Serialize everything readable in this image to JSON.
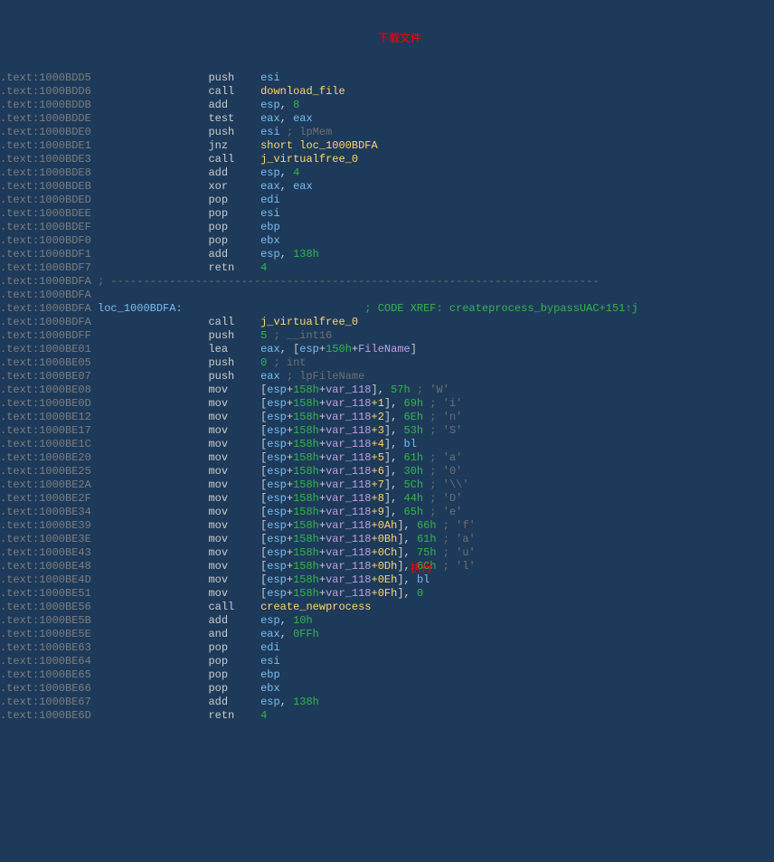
{
  "anno": {
    "download": "下载文件",
    "run": "执行"
  },
  "lines": [
    {
      "addr": ".text:1000BDD5",
      "col2": "",
      "mnem": "push",
      "ops": [
        {
          "t": "reg",
          "v": "esi"
        }
      ]
    },
    {
      "addr": ".text:1000BDD6",
      "col2": "",
      "mnem": "call",
      "ops": [
        {
          "t": "func",
          "v": "download_file"
        }
      ]
    },
    {
      "addr": ".text:1000BDDB",
      "col2": "",
      "mnem": "add",
      "ops": [
        {
          "t": "reg",
          "v": "esp"
        },
        {
          "t": "txt",
          "v": ", "
        },
        {
          "t": "num",
          "v": "8"
        }
      ]
    },
    {
      "addr": ".text:1000BDDE",
      "col2": "",
      "mnem": "test",
      "ops": [
        {
          "t": "reg",
          "v": "eax"
        },
        {
          "t": "txt",
          "v": ", "
        },
        {
          "t": "reg",
          "v": "eax"
        }
      ]
    },
    {
      "addr": ".text:1000BDE0",
      "col2": "",
      "mnem": "push",
      "ops": [
        {
          "t": "reg",
          "v": "esi"
        }
      ],
      "cmt": "; lpMem",
      "cmtcol": 42
    },
    {
      "addr": ".text:1000BDE1",
      "col2": "",
      "mnem": "jnz",
      "ops": [
        {
          "t": "func",
          "v": "short loc_1000BDFA"
        }
      ]
    },
    {
      "addr": ".text:1000BDE3",
      "col2": "",
      "mnem": "call",
      "ops": [
        {
          "t": "func",
          "v": "j_virtualfree_0"
        }
      ]
    },
    {
      "addr": ".text:1000BDE8",
      "col2": "",
      "mnem": "add",
      "ops": [
        {
          "t": "reg",
          "v": "esp"
        },
        {
          "t": "txt",
          "v": ", "
        },
        {
          "t": "num",
          "v": "4"
        }
      ]
    },
    {
      "addr": ".text:1000BDEB",
      "col2": "",
      "mnem": "xor",
      "ops": [
        {
          "t": "reg",
          "v": "eax"
        },
        {
          "t": "txt",
          "v": ", "
        },
        {
          "t": "reg",
          "v": "eax"
        }
      ]
    },
    {
      "addr": ".text:1000BDED",
      "col2": "",
      "mnem": "pop",
      "ops": [
        {
          "t": "reg",
          "v": "edi"
        }
      ]
    },
    {
      "addr": ".text:1000BDEE",
      "col2": "",
      "mnem": "pop",
      "ops": [
        {
          "t": "reg",
          "v": "esi"
        }
      ]
    },
    {
      "addr": ".text:1000BDEF",
      "col2": "",
      "mnem": "pop",
      "ops": [
        {
          "t": "reg",
          "v": "ebp"
        }
      ]
    },
    {
      "addr": ".text:1000BDF0",
      "col2": "",
      "mnem": "pop",
      "ops": [
        {
          "t": "reg",
          "v": "ebx"
        }
      ]
    },
    {
      "addr": ".text:1000BDF1",
      "col2": "",
      "mnem": "add",
      "ops": [
        {
          "t": "reg",
          "v": "esp"
        },
        {
          "t": "txt",
          "v": ", "
        },
        {
          "t": "num",
          "v": "138h"
        }
      ]
    },
    {
      "addr": ".text:1000BDF7",
      "col2": "",
      "mnem": "retn",
      "ops": [
        {
          "t": "num",
          "v": "4"
        }
      ]
    },
    {
      "addr": ".text:1000BDFA",
      "sep": true
    },
    {
      "addr": ".text:1000BDFA",
      "blank": true
    },
    {
      "addr": ".text:1000BDFA",
      "loc": "loc_1000BDFA:",
      "xref": "; CODE XREF: createprocess_bypassUAC+151↑j"
    },
    {
      "addr": ".text:1000BDFA",
      "col2": "",
      "mnem": "call",
      "ops": [
        {
          "t": "func",
          "v": "j_virtualfree_0"
        }
      ]
    },
    {
      "addr": ".text:1000BDFF",
      "col2": "",
      "mnem": "push",
      "ops": [
        {
          "t": "num",
          "v": "5"
        }
      ],
      "cmt": "; __int16",
      "cmtcol": 42
    },
    {
      "addr": ".text:1000BE01",
      "col2": "",
      "mnem": "lea",
      "ops": [
        {
          "t": "reg",
          "v": "eax"
        },
        {
          "t": "txt",
          "v": ", ["
        },
        {
          "t": "reg",
          "v": "esp"
        },
        {
          "t": "txt",
          "v": "+"
        },
        {
          "t": "num",
          "v": "150h"
        },
        {
          "t": "txt",
          "v": "+"
        },
        {
          "t": "var",
          "v": "FileName"
        },
        {
          "t": "txt",
          "v": "]"
        }
      ]
    },
    {
      "addr": ".text:1000BE05",
      "col2": "",
      "mnem": "push",
      "ops": [
        {
          "t": "num",
          "v": "0"
        }
      ],
      "cmt": "; int",
      "cmtcol": 42
    },
    {
      "addr": ".text:1000BE07",
      "col2": "",
      "mnem": "push",
      "ops": [
        {
          "t": "reg",
          "v": "eax"
        }
      ],
      "cmt": "; lpFileName",
      "cmtcol": 42
    },
    {
      "addr": ".text:1000BE08",
      "col2": "",
      "mnem": "mov",
      "ops": [
        {
          "t": "txt",
          "v": "["
        },
        {
          "t": "reg",
          "v": "esp"
        },
        {
          "t": "txt",
          "v": "+"
        },
        {
          "t": "num",
          "v": "158h"
        },
        {
          "t": "txt",
          "v": "+"
        },
        {
          "t": "var",
          "v": "var_118"
        },
        {
          "t": "txt",
          "v": "], "
        },
        {
          "t": "num",
          "v": "57h"
        }
      ],
      "cmt2": " ; 'W'"
    },
    {
      "addr": ".text:1000BE0D",
      "col2": "",
      "mnem": "mov",
      "ops": [
        {
          "t": "txt",
          "v": "["
        },
        {
          "t": "reg",
          "v": "esp"
        },
        {
          "t": "txt",
          "v": "+"
        },
        {
          "t": "num",
          "v": "158h"
        },
        {
          "t": "txt",
          "v": "+"
        },
        {
          "t": "var",
          "v": "var_118"
        },
        {
          "t": "off",
          "v": "+1"
        },
        {
          "t": "txt",
          "v": "], "
        },
        {
          "t": "num",
          "v": "69h"
        }
      ],
      "cmt2": " ; 'i'"
    },
    {
      "addr": ".text:1000BE12",
      "col2": "",
      "mnem": "mov",
      "ops": [
        {
          "t": "txt",
          "v": "["
        },
        {
          "t": "reg",
          "v": "esp"
        },
        {
          "t": "txt",
          "v": "+"
        },
        {
          "t": "num",
          "v": "158h"
        },
        {
          "t": "txt",
          "v": "+"
        },
        {
          "t": "var",
          "v": "var_118"
        },
        {
          "t": "off",
          "v": "+2"
        },
        {
          "t": "txt",
          "v": "], "
        },
        {
          "t": "num",
          "v": "6Eh"
        }
      ],
      "cmt2": " ; 'n'"
    },
    {
      "addr": ".text:1000BE17",
      "col2": "",
      "mnem": "mov",
      "ops": [
        {
          "t": "txt",
          "v": "["
        },
        {
          "t": "reg",
          "v": "esp"
        },
        {
          "t": "txt",
          "v": "+"
        },
        {
          "t": "num",
          "v": "158h"
        },
        {
          "t": "txt",
          "v": "+"
        },
        {
          "t": "var",
          "v": "var_118"
        },
        {
          "t": "off",
          "v": "+3"
        },
        {
          "t": "txt",
          "v": "], "
        },
        {
          "t": "num",
          "v": "53h"
        }
      ],
      "cmt2": " ; 'S'"
    },
    {
      "addr": ".text:1000BE1C",
      "col2": "",
      "mnem": "mov",
      "ops": [
        {
          "t": "txt",
          "v": "["
        },
        {
          "t": "reg",
          "v": "esp"
        },
        {
          "t": "txt",
          "v": "+"
        },
        {
          "t": "num",
          "v": "158h"
        },
        {
          "t": "txt",
          "v": "+"
        },
        {
          "t": "var",
          "v": "var_118"
        },
        {
          "t": "off",
          "v": "+4"
        },
        {
          "t": "txt",
          "v": "], "
        },
        {
          "t": "reg",
          "v": "bl"
        }
      ]
    },
    {
      "addr": ".text:1000BE20",
      "col2": "",
      "mnem": "mov",
      "ops": [
        {
          "t": "txt",
          "v": "["
        },
        {
          "t": "reg",
          "v": "esp"
        },
        {
          "t": "txt",
          "v": "+"
        },
        {
          "t": "num",
          "v": "158h"
        },
        {
          "t": "txt",
          "v": "+"
        },
        {
          "t": "var",
          "v": "var_118"
        },
        {
          "t": "off",
          "v": "+5"
        },
        {
          "t": "txt",
          "v": "], "
        },
        {
          "t": "num",
          "v": "61h"
        }
      ],
      "cmt2": " ; 'a'"
    },
    {
      "addr": ".text:1000BE25",
      "col2": "",
      "mnem": "mov",
      "ops": [
        {
          "t": "txt",
          "v": "["
        },
        {
          "t": "reg",
          "v": "esp"
        },
        {
          "t": "txt",
          "v": "+"
        },
        {
          "t": "num",
          "v": "158h"
        },
        {
          "t": "txt",
          "v": "+"
        },
        {
          "t": "var",
          "v": "var_118"
        },
        {
          "t": "off",
          "v": "+6"
        },
        {
          "t": "txt",
          "v": "], "
        },
        {
          "t": "num",
          "v": "30h"
        }
      ],
      "cmt2": " ; '0'"
    },
    {
      "addr": ".text:1000BE2A",
      "col2": "",
      "mnem": "mov",
      "ops": [
        {
          "t": "txt",
          "v": "["
        },
        {
          "t": "reg",
          "v": "esp"
        },
        {
          "t": "txt",
          "v": "+"
        },
        {
          "t": "num",
          "v": "158h"
        },
        {
          "t": "txt",
          "v": "+"
        },
        {
          "t": "var",
          "v": "var_118"
        },
        {
          "t": "off",
          "v": "+7"
        },
        {
          "t": "txt",
          "v": "], "
        },
        {
          "t": "num",
          "v": "5Ch"
        }
      ],
      "cmt2": " ; '\\\\'"
    },
    {
      "addr": ".text:1000BE2F",
      "col2": "",
      "mnem": "mov",
      "ops": [
        {
          "t": "txt",
          "v": "["
        },
        {
          "t": "reg",
          "v": "esp"
        },
        {
          "t": "txt",
          "v": "+"
        },
        {
          "t": "num",
          "v": "158h"
        },
        {
          "t": "txt",
          "v": "+"
        },
        {
          "t": "var",
          "v": "var_118"
        },
        {
          "t": "off",
          "v": "+8"
        },
        {
          "t": "txt",
          "v": "], "
        },
        {
          "t": "num",
          "v": "44h"
        }
      ],
      "cmt2": " ; 'D'"
    },
    {
      "addr": ".text:1000BE34",
      "col2": "",
      "mnem": "mov",
      "ops": [
        {
          "t": "txt",
          "v": "["
        },
        {
          "t": "reg",
          "v": "esp"
        },
        {
          "t": "txt",
          "v": "+"
        },
        {
          "t": "num",
          "v": "158h"
        },
        {
          "t": "txt",
          "v": "+"
        },
        {
          "t": "var",
          "v": "var_118"
        },
        {
          "t": "off",
          "v": "+9"
        },
        {
          "t": "txt",
          "v": "], "
        },
        {
          "t": "num",
          "v": "65h"
        }
      ],
      "cmt2": " ; 'e'"
    },
    {
      "addr": ".text:1000BE39",
      "col2": "",
      "mnem": "mov",
      "ops": [
        {
          "t": "txt",
          "v": "["
        },
        {
          "t": "reg",
          "v": "esp"
        },
        {
          "t": "txt",
          "v": "+"
        },
        {
          "t": "num",
          "v": "158h"
        },
        {
          "t": "txt",
          "v": "+"
        },
        {
          "t": "var",
          "v": "var_118"
        },
        {
          "t": "off",
          "v": "+0Ah"
        },
        {
          "t": "txt",
          "v": "], "
        },
        {
          "t": "num",
          "v": "66h"
        }
      ],
      "cmt2": " ; 'f'"
    },
    {
      "addr": ".text:1000BE3E",
      "col2": "",
      "mnem": "mov",
      "ops": [
        {
          "t": "txt",
          "v": "["
        },
        {
          "t": "reg",
          "v": "esp"
        },
        {
          "t": "txt",
          "v": "+"
        },
        {
          "t": "num",
          "v": "158h"
        },
        {
          "t": "txt",
          "v": "+"
        },
        {
          "t": "var",
          "v": "var_118"
        },
        {
          "t": "off",
          "v": "+0Bh"
        },
        {
          "t": "txt",
          "v": "], "
        },
        {
          "t": "num",
          "v": "61h"
        }
      ],
      "cmt2": " ; 'a'"
    },
    {
      "addr": ".text:1000BE43",
      "col2": "",
      "mnem": "mov",
      "ops": [
        {
          "t": "txt",
          "v": "["
        },
        {
          "t": "reg",
          "v": "esp"
        },
        {
          "t": "txt",
          "v": "+"
        },
        {
          "t": "num",
          "v": "158h"
        },
        {
          "t": "txt",
          "v": "+"
        },
        {
          "t": "var",
          "v": "var_118"
        },
        {
          "t": "off",
          "v": "+0Ch"
        },
        {
          "t": "txt",
          "v": "], "
        },
        {
          "t": "num",
          "v": "75h"
        }
      ],
      "cmt2": " ; 'u'"
    },
    {
      "addr": ".text:1000BE48",
      "col2": "",
      "mnem": "mov",
      "ops": [
        {
          "t": "txt",
          "v": "["
        },
        {
          "t": "reg",
          "v": "esp"
        },
        {
          "t": "txt",
          "v": "+"
        },
        {
          "t": "num",
          "v": "158h"
        },
        {
          "t": "txt",
          "v": "+"
        },
        {
          "t": "var",
          "v": "var_118"
        },
        {
          "t": "off",
          "v": "+0Dh"
        },
        {
          "t": "txt",
          "v": "], "
        },
        {
          "t": "num",
          "v": "6Ch"
        }
      ],
      "cmt2": " ; 'l'"
    },
    {
      "addr": ".text:1000BE4D",
      "col2": "",
      "mnem": "mov",
      "ops": [
        {
          "t": "txt",
          "v": "["
        },
        {
          "t": "reg",
          "v": "esp"
        },
        {
          "t": "txt",
          "v": "+"
        },
        {
          "t": "num",
          "v": "158h"
        },
        {
          "t": "txt",
          "v": "+"
        },
        {
          "t": "var",
          "v": "var_118"
        },
        {
          "t": "off",
          "v": "+0Eh"
        },
        {
          "t": "txt",
          "v": "], "
        },
        {
          "t": "reg",
          "v": "bl"
        }
      ]
    },
    {
      "addr": ".text:1000BE51",
      "col2": "",
      "mnem": "mov",
      "ops": [
        {
          "t": "txt",
          "v": "["
        },
        {
          "t": "reg",
          "v": "esp"
        },
        {
          "t": "txt",
          "v": "+"
        },
        {
          "t": "num",
          "v": "158h"
        },
        {
          "t": "txt",
          "v": "+"
        },
        {
          "t": "var",
          "v": "var_118"
        },
        {
          "t": "off",
          "v": "+0Fh"
        },
        {
          "t": "txt",
          "v": "], "
        },
        {
          "t": "num",
          "v": "0"
        }
      ]
    },
    {
      "addr": ".text:1000BE56",
      "col2": "",
      "mnem": "call",
      "ops": [
        {
          "t": "func",
          "v": "create_newprocess"
        }
      ]
    },
    {
      "addr": ".text:1000BE5B",
      "col2": "",
      "mnem": "add",
      "ops": [
        {
          "t": "reg",
          "v": "esp"
        },
        {
          "t": "txt",
          "v": ", "
        },
        {
          "t": "num",
          "v": "10h"
        }
      ]
    },
    {
      "addr": ".text:1000BE5E",
      "col2": "",
      "mnem": "and",
      "ops": [
        {
          "t": "reg",
          "v": "eax"
        },
        {
          "t": "txt",
          "v": ", "
        },
        {
          "t": "num",
          "v": "0FFh"
        }
      ]
    },
    {
      "addr": ".text:1000BE63",
      "col2": "",
      "mnem": "pop",
      "ops": [
        {
          "t": "reg",
          "v": "edi"
        }
      ]
    },
    {
      "addr": ".text:1000BE64",
      "col2": "",
      "mnem": "pop",
      "ops": [
        {
          "t": "reg",
          "v": "esi"
        }
      ]
    },
    {
      "addr": ".text:1000BE65",
      "col2": "",
      "mnem": "pop",
      "ops": [
        {
          "t": "reg",
          "v": "ebp"
        }
      ]
    },
    {
      "addr": ".text:1000BE66",
      "col2": "",
      "mnem": "pop",
      "ops": [
        {
          "t": "reg",
          "v": "ebx"
        }
      ]
    },
    {
      "addr": ".text:1000BE67",
      "col2": "",
      "mnem": "add",
      "ops": [
        {
          "t": "reg",
          "v": "esp"
        },
        {
          "t": "txt",
          "v": ", "
        },
        {
          "t": "num",
          "v": "138h"
        }
      ]
    },
    {
      "addr": ".text:1000BE6D",
      "col2": "",
      "mnem": "retn",
      "ops": [
        {
          "t": "num",
          "v": "4"
        }
      ]
    }
  ],
  "cols": {
    "mnem": 32,
    "ops": 40,
    "cmt": 56,
    "loc_xref": 56
  }
}
